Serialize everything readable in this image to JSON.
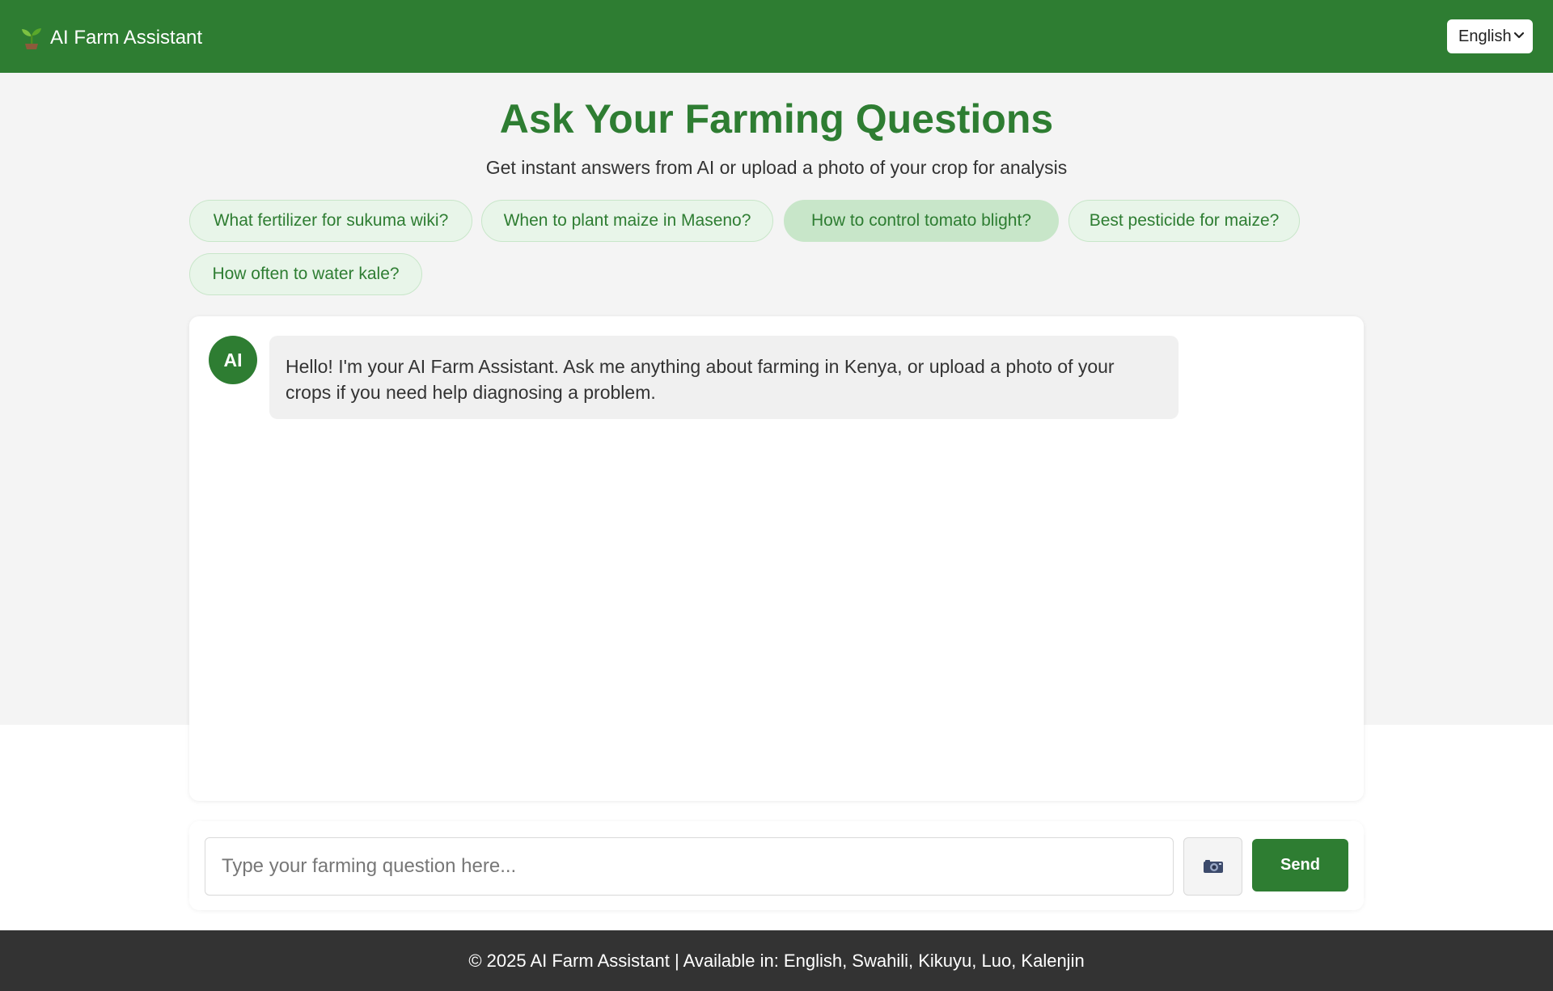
{
  "header": {
    "brand_icon": "seedling-icon",
    "title": "AI Farm Assistant",
    "language": {
      "selected": "English"
    }
  },
  "hero": {
    "title": "Ask Your Farming Questions",
    "subtitle": "Get instant answers from AI or upload a photo of your crop for analysis"
  },
  "suggestions": [
    {
      "label": "What fertilizer for sukuma wiki?"
    },
    {
      "label": "When to plant maize in Maseno?"
    },
    {
      "label": "How to control tomato blight?",
      "highlighted": true
    },
    {
      "label": "Best pesticide for maize?"
    },
    {
      "label": "How often to water kale?"
    }
  ],
  "chat": {
    "messages": [
      {
        "sender": "AI",
        "text": "Hello! I'm your AI Farm Assistant. Ask me anything about farming in Kenya, or upload a photo of your crops if you need help diagnosing a problem."
      }
    ]
  },
  "composer": {
    "placeholder": "Type your farming question here...",
    "value": "",
    "camera_icon": "camera-icon",
    "send_label": "Send"
  },
  "footer": {
    "text": "© 2025 AI Farm Assistant | Available in: English, Swahili, Kikuyu, Luo, Kalenjin"
  },
  "colors": {
    "primary": "#2e7d32",
    "chip_bg": "#e8f5e9",
    "chip_active_bg": "#c8e6c9",
    "page_bg": "#f4f4f4",
    "bubble_bg": "#f0f0f0",
    "footer_bg": "#333333"
  }
}
